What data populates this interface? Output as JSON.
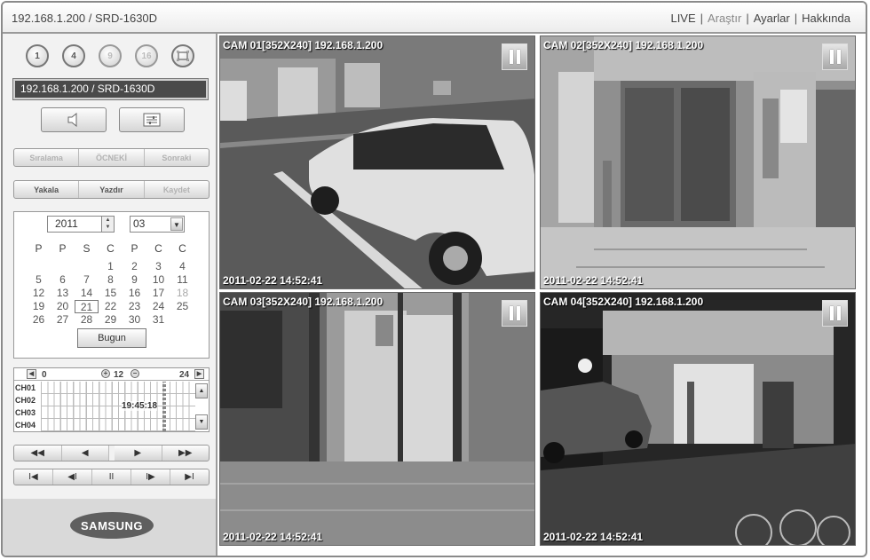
{
  "header": {
    "title": "192.168.1.200 / SRD-1630D",
    "nav": [
      {
        "label": "LIVE"
      },
      {
        "label": "Araştır"
      },
      {
        "label": "Ayarlar"
      },
      {
        "label": "Hakkında"
      }
    ]
  },
  "split_buttons": [
    "1",
    "4",
    "9",
    "16"
  ],
  "address_display": "192.168.1.200   / SRD-1630D",
  "icons": {
    "audio": "speaker-icon",
    "settings": "settings-panel-icon",
    "fullscreen": "fullscreen-icon",
    "logo": "samsung-logo"
  },
  "sequence_group": {
    "labels": [
      "Sıralama",
      "ÖCNEKİ",
      "Sonraki"
    ]
  },
  "capture_group": {
    "labels": [
      "Yakala",
      "Yazdır",
      "Kaydet"
    ]
  },
  "calendar": {
    "year": "2011",
    "month": "03",
    "weekdays": [
      "P",
      "P",
      "S",
      "C",
      "P",
      "C",
      "C"
    ],
    "days": [
      "",
      "",
      "",
      "1",
      "2",
      "3",
      "4",
      "5",
      "6",
      "7",
      "8",
      "9",
      "10",
      "11",
      "12",
      "13",
      "14",
      "15",
      "16",
      "17",
      "18",
      "19",
      "20",
      "21",
      "22",
      "23",
      "24",
      "25",
      "26",
      "27",
      "28",
      "29",
      "30",
      "31",
      ""
    ],
    "selected_day": "21",
    "today_label": "Bugun"
  },
  "timeline": {
    "start": "0",
    "mid": "12",
    "end": "24",
    "channels": [
      "CH01",
      "CH02",
      "CH03",
      "CH04"
    ],
    "current_time": "19:45:18"
  },
  "playback_row1": [
    "◀◀",
    "◀",
    "▶",
    "▶▶"
  ],
  "playback_row2": [
    "I◀",
    "◀I",
    "II",
    "I▶",
    "▶I"
  ],
  "brand": "SAMSUNG",
  "cameras": [
    {
      "label": "CAM 01[352X240] 192.168.1.200",
      "timestamp": "2011-02-22 14:52:41"
    },
    {
      "label": "CAM 02[352X240] 192.168.1.200",
      "timestamp": "2011-02-22 14:52:41"
    },
    {
      "label": "CAM 03[352X240] 192.168.1.200",
      "timestamp": "2011-02-22 14:52:41"
    },
    {
      "label": "CAM 04[352X240] 192.168.1.200",
      "timestamp": "2011-02-22 14:52:41"
    }
  ]
}
